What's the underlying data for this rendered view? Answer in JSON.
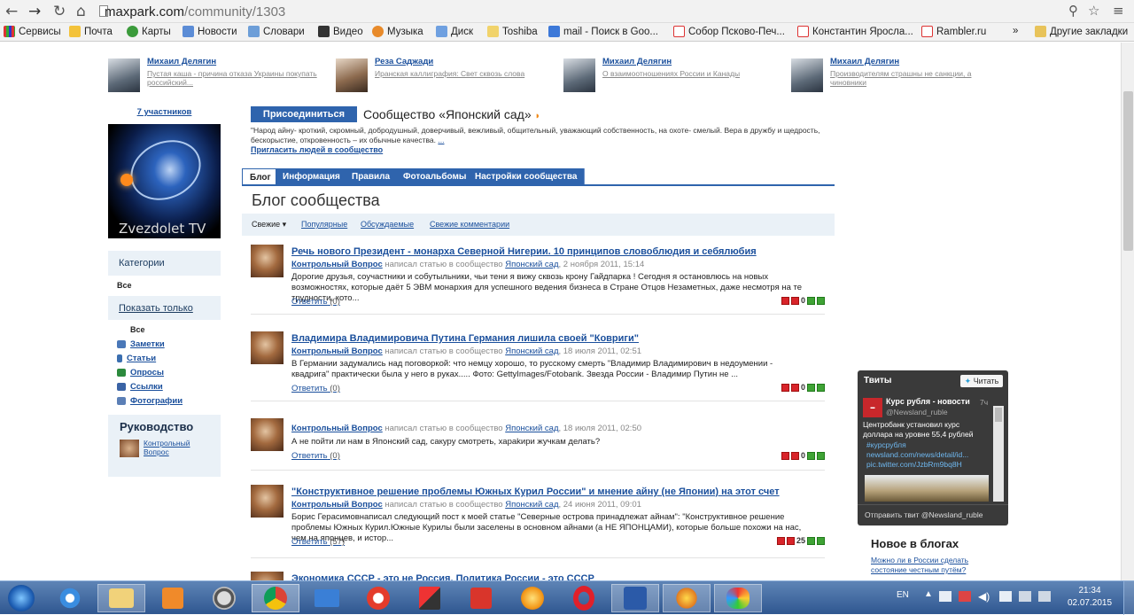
{
  "browser": {
    "url_host": "maxpark.com",
    "url_path": "/community/1303",
    "bookmarks": [
      "Сервисы",
      "Почта",
      "Карты",
      "Новости",
      "Словари",
      "Видео",
      "Музыка",
      "Диск",
      "Toshiba",
      "mail - Поиск в Goo...",
      "Собор Псково-Печ...",
      "Константин Яросла...",
      "Rambler.ru"
    ],
    "more": "»",
    "other_bookmarks": "Другие закладки"
  },
  "top_authors": [
    {
      "name": "Михаил Делягин",
      "text": "Пустая каша - причина отказа Украины покупать российский..."
    },
    {
      "name": "Реза Саджади",
      "text": "Иранская каллиграфия: Свет сквозь слова"
    },
    {
      "name": "Михаил Делягин",
      "text": "О взаимоотношениях России и Канады"
    },
    {
      "name": "Михаил Делягин",
      "text": "Производителям страшны не санкции, а чиновники"
    }
  ],
  "sidebar": {
    "members": "7 участников",
    "logo_text": "Zvezdolet TV",
    "categories_title": "Категории",
    "categories_all": "Все",
    "show_only_title": "Показать только",
    "show_all": "Все",
    "filters": [
      "Заметки",
      "Статьи",
      "Опросы",
      "Ссылки",
      "Фотографии"
    ],
    "leadership_title": "Руководство",
    "leader_name": "Контрольный Вопрос"
  },
  "community": {
    "join_button": "Присоединиться",
    "title": "Сообщество «Японский сад»",
    "description": "\"Народ айну- кроткий, скромный, добродушный, доверчивый, вежливый, общительный, уважающий собственность, на охоте- смелый. Вера в дружбу и щедрость, бескорыстие, откровенность – их обычные качества.",
    "more": "...",
    "invite": "Пригласить людей в сообщество",
    "tabs": [
      "Блог",
      "Информация",
      "Правила",
      "Фотоальбомы",
      "Настройки сообщества"
    ],
    "blog_title": "Блог сообщества",
    "sort": [
      "Свежие ▾",
      "Популярные",
      "Обсуждаемые",
      "Свежие комментарии"
    ]
  },
  "posts": [
    {
      "title": "Речь нового Президент - монарха Северной Нигерии. 10 принципов словоблюдия и себялюбия",
      "author": "Контрольный Вопрос",
      "wrote": "написал статью в сообщество",
      "community": "Японский сад",
      "date": ", 2 ноября 2011, 15:14",
      "body": "Дорогие друзья, соучастники и собутыльники, чьи тени я вижу сквозь крону Гайдпарка ! Сегодня я остановлюсь на новых возможностях, которые даёт 5 ЭВМ монархия для успешного ведения бизнеса в Стране Отцов Незаметных, даже несмотря на те трудности, кото...",
      "reply": "Ответить",
      "count": "(0)",
      "score": "0"
    },
    {
      "title": "Владимира Владимировича Путина Германия лишила своей \"Ковриги\"",
      "author": "Контрольный Вопрос",
      "wrote": "написал статью в сообщество",
      "community": "Японский сад",
      "date": ", 18 июля 2011, 02:51",
      "body": "В Германии задумались над поговоркой: что немцу хорошо, то русскому смерть \"Владимир Владимирович в недоумении - квадрига\" практически была у него в руках..... Фото: GettyImages/Fotobank. Звезда России - Владимир Путин не ...",
      "reply": "Ответить",
      "count": "(0)",
      "score": "0"
    },
    {
      "title": "",
      "author": "Контрольный Вопрос",
      "wrote": "написал статью в сообщество",
      "community": "Японский сад",
      "date": ", 18 июля 2011, 02:50",
      "body": "А не пойти ли нам в Японский сад, сакуру смотреть, хараkири жучкам делать?",
      "reply": "Ответить",
      "count": "(0)",
      "score": "0"
    },
    {
      "title": "\"Конструктивное решение проблемы Южных Курил России\" и мнение айну (не Японии) на этот счет",
      "author": "Контрольный Вопрос",
      "wrote": "написал статью в сообщество",
      "community": "Японский сад",
      "date": ", 24 июня 2011, 09:01",
      "body": "Борис Герасимовнаписал следующий пост к моей статье \"Северные острова принадлежат айнам\": \"Конструктивное решение проблемы Южных Курил.Южные Курилы были заселены в основном айнами (а НЕ ЯПОНЦАМИ), которые больше похожи на нас, чем на японцев, и истор...",
      "reply": "Ответить",
      "count": "(57)",
      "score": "25"
    },
    {
      "title": "Экономика СССР - это не Россия. Политика России - это СССР",
      "author": "",
      "wrote": "",
      "community": "",
      "date": "",
      "body": "",
      "reply": "",
      "count": "",
      "score": ""
    }
  ],
  "twitter": {
    "header": "Твиты",
    "follow": "Читать",
    "account_name": "Курс рубля - новости",
    "handle": "@Newsland_ruble",
    "age": "7ч",
    "tweet": "Центробанк установил курс доллара на уровне 55,4 рублей",
    "hashtag": "#курсрубля",
    "link1": "newsland.com/news/detail/id...",
    "link2": "pic.twitter.com/JzbRm9bq8H",
    "send": "Отправить твит @Newsland_ruble"
  },
  "new_in_blogs": {
    "title": "Новое в блогах",
    "item": "Можно ли в России сделать состояние честным путём?"
  },
  "taskbar": {
    "lang": "EN",
    "time": "21:34",
    "date": "02.07.2015"
  }
}
